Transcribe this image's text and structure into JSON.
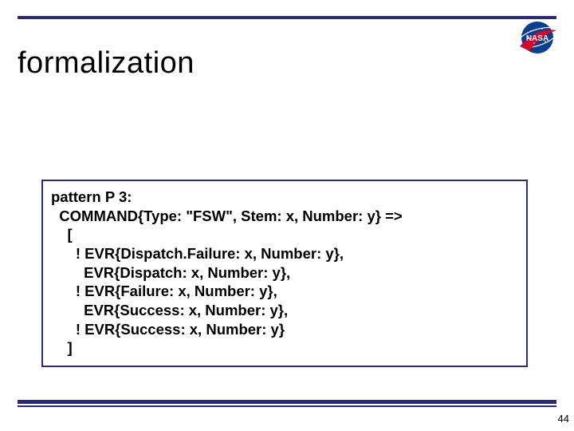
{
  "title": "formalization",
  "code": {
    "l0": "pattern P 3:",
    "l1": "  COMMAND{Type: \"FSW\", Stem: x, Number: y} =>",
    "l2": "    [",
    "l3": "      ! EVR{Dispatch.Failure: x, Number: y},",
    "l4": "        EVR{Dispatch: x, Number: y},",
    "l5": "      ! EVR{Failure: x, Number: y},",
    "l6": "        EVR{Success: x, Number: y},",
    "l7": "      ! EVR{Success: x, Number: y}",
    "l8": "    ]"
  },
  "page_number": "44"
}
